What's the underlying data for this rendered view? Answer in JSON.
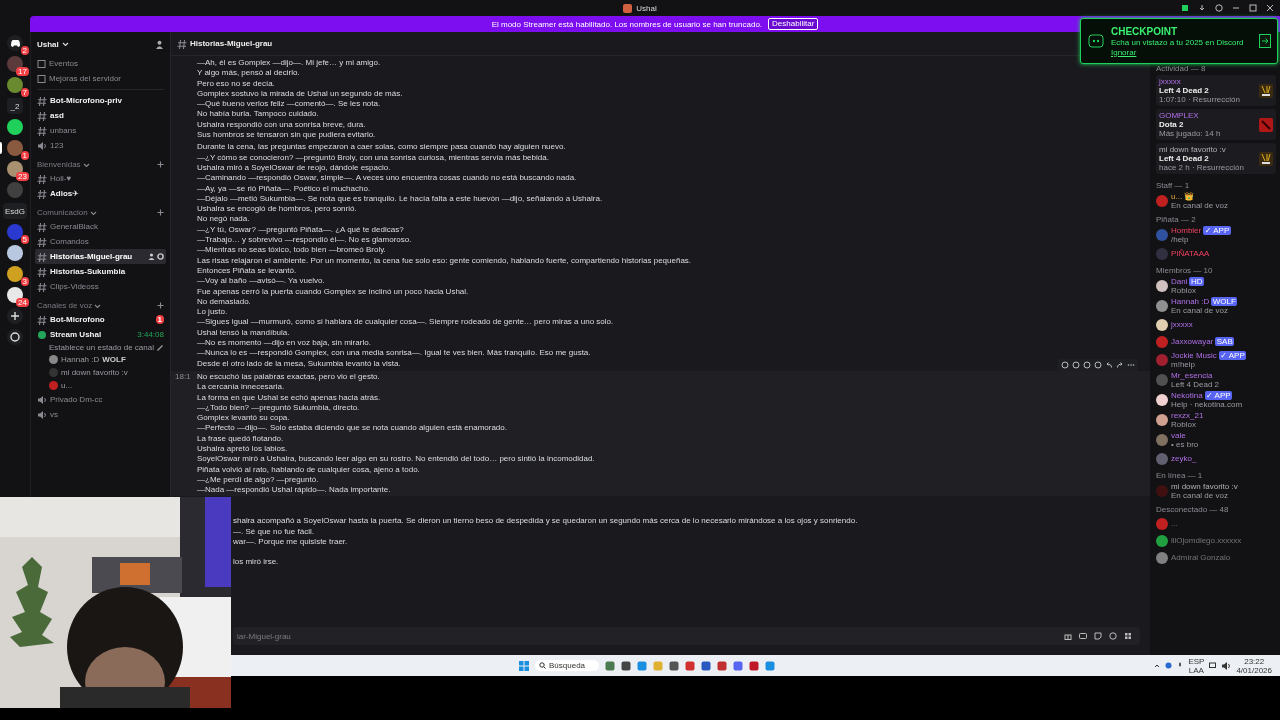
{
  "window": {
    "title": "Ushal"
  },
  "banner": {
    "text": "El modo Streamer está habilitado. Los nombres de usuario se han truncado.",
    "button": "Deshabilitar"
  },
  "rail": [
    {
      "kind": "discord",
      "badge": "2",
      "selected": false
    },
    {
      "kind": "avatar",
      "color": "#5a3a3a",
      "badge": "17",
      "selected": false
    },
    {
      "kind": "avatar",
      "color": "#6a8a30",
      "badge": "7",
      "selected": false
    },
    {
      "kind": "text",
      "label": "_2",
      "selected": false
    },
    {
      "kind": "avatar",
      "color": "#1fd15a",
      "selected": false
    },
    {
      "kind": "avatar",
      "color": "#8a5a40",
      "badge": "1",
      "selected": true
    },
    {
      "kind": "avatar",
      "color": "#a89070",
      "badge": "23",
      "selected": false
    },
    {
      "kind": "avatar",
      "color": "#404040",
      "selected": false
    },
    {
      "kind": "text",
      "label": "EsdG",
      "selected": false
    },
    {
      "kind": "avatar",
      "color": "#2a3ad0",
      "badge": "5",
      "selected": false
    },
    {
      "kind": "avatar",
      "color": "#b8c8e0",
      "selected": false
    },
    {
      "kind": "avatar",
      "color": "#d0a020",
      "badge": "3",
      "selected": false
    },
    {
      "kind": "avatar",
      "color": "#e8e8e8",
      "badge": "24",
      "selected": false
    },
    {
      "kind": "add"
    },
    {
      "kind": "discover"
    }
  ],
  "sidebar": {
    "server": "Ushal",
    "items": [
      {
        "kind": "nav",
        "label": "Eventos"
      },
      {
        "kind": "nav",
        "label": "Mejoras del servidor"
      },
      {
        "kind": "divider"
      },
      {
        "kind": "text",
        "label": "Bot-Microfono-priv",
        "unread": true,
        "selected": false
      },
      {
        "kind": "text",
        "label": "asd",
        "unread": true,
        "selected": false
      },
      {
        "kind": "text",
        "label": "unbans",
        "unread": false,
        "selected": false
      },
      {
        "kind": "voice",
        "label": "123",
        "unread": false,
        "selected": false
      },
      {
        "kind": "category",
        "label": "Bienvenidas"
      },
      {
        "kind": "text",
        "label": "Holi-♥",
        "unread": false,
        "selected": false
      },
      {
        "kind": "text",
        "label": "Adios✈",
        "unread": true,
        "selected": false
      },
      {
        "kind": "category",
        "label": "Comunicacion"
      },
      {
        "kind": "text",
        "label": "GeneralBlack",
        "unread": false,
        "selected": false
      },
      {
        "kind": "text",
        "label": "Comandos",
        "unread": false,
        "selected": false
      },
      {
        "kind": "text",
        "label": "Historias-Miguel-grau",
        "unread": true,
        "selected": true
      },
      {
        "kind": "text",
        "label": "Historias-Sukumbia",
        "unread": true,
        "selected": false
      },
      {
        "kind": "text",
        "label": "Clips-Videoss",
        "unread": false,
        "selected": false
      },
      {
        "kind": "category",
        "label": "Canales de voz"
      },
      {
        "kind": "text",
        "label": "Bot-Microfono",
        "unread": true,
        "selected": false,
        "badge": "1"
      },
      {
        "kind": "stream",
        "label": "Stream Ushal",
        "timer": "3:44:08"
      },
      {
        "kind": "status",
        "label": "Establece un estado de canal"
      },
      {
        "kind": "user",
        "label": "Hannah :D",
        "tag": "WOLF",
        "color": "#888888"
      },
      {
        "kind": "user",
        "label": "mi down favorito :v",
        "color": "#333333"
      },
      {
        "kind": "user",
        "label": "u...",
        "color": "#c02020"
      },
      {
        "kind": "voice",
        "label": "Privado Dm-cc",
        "unread": false,
        "selected": false
      },
      {
        "kind": "voice",
        "label": "vs",
        "unread": false,
        "selected": false
      }
    ]
  },
  "channel": {
    "name": "Historias-Miguel-grau"
  },
  "messages": [
    {
      "hovered": false,
      "cut": false,
      "lines": [
        "—Ah, él es Gomplex —dijo—. Mi jefe… y mi amigo.",
        "Y algo más, pensó al decirlo.",
        "Pero eso no se decía.",
        "Gomplex sostuvo la mirada de Ushal un segundo de más.",
        "—Qué bueno verlos feliz —comentó—. Se les nota.",
        "No había burla. Tampoco cuidado.",
        "Ushalra respondió con una sonrisa breve, dura.",
        "Sus hombros se tensaron sin que pudiera evitarlo."
      ]
    },
    {
      "hovered": false,
      "cut": false,
      "lines": [
        "Durante la cena, las preguntas empezaron a caer solas, como siempre pasa cuando hay alguien nuevo.",
        "—¿Y cómo se conocieron? —preguntó Broly, con una sonrisa curiosa, mientras servía más bebida.",
        "Ushalra miró a SoyelOswar de reojo, dándole espacio.",
        "—Caminando —respondió Oswar, simple—. A veces uno encuentra cosas cuando no está buscando nada.",
        "—Ay, ya —se rió Piñata—. Poético el muchacho.",
        "—Déjalo —metió Sukumbia—. Se nota que es tranquilo. Le hacía falta a este huevón —dijo, señalando a Ushalra.",
        "Ushalra se encogió de hombros, pero sonrió.",
        "No negó nada.",
        "—¿Y tú, Oswar? —preguntó Piñata—. ¿A qué te dedicas?",
        "—Trabajo… y sobrevivo —respondió él—. No es glamoroso.",
        "—Mientras no seas tóxico, todo bien —bromeó Broly.",
        "Las risas relajaron el ambiente. Por un momento, la cena fue solo eso: gente comiendo, hablando fuerte, compartiendo historias pequeñas.",
        "Entonces Piñata se levantó.",
        "—Voy al baño —avisó—. Ya vuelvo.",
        "Fue apenas cerró la puerta cuando Gomplex se inclinó un poco hacia Ushal.",
        "No demasiado.",
        "Lo justo.",
        "—Sigues igual —murmuró, como si hablara de cualquier cosa—. Siempre rodeado de gente… pero miras a uno solo.",
        "Ushal tensó la mandíbula.",
        "—No es momento —dijo en voz baja, sin mirarlo.",
        "—Nunca lo es —respondió Gomplex, con una media sonrisa—. Igual te ves bien. Más tranquilo. Eso me gusta.",
        "Desde el otro lado de la mesa, Sukumbia levantó la vista."
      ]
    },
    {
      "hovered": true,
      "cut": false,
      "time": "18:1",
      "lines": [
        "No escuchó las palabras exactas, pero vio el gesto.",
        "La cercanía innecesaria.",
        "La forma en que Ushal se echó apenas hacia atrás.",
        "—¿Todo bien? —preguntó Sukumbia, directo.",
        "Gomplex levantó su copa.",
        "—Perfecto —dijo—. Solo estaba diciendo que se nota cuando alguien está enamorado.",
        "La frase quedó flotando.",
        "Ushalra apretó los labios.",
        "SoyelOswar miró a Ushalra, buscando leer algo en su rostro. No entendió del todo… pero sintió la incomodidad.",
        "Piñata volvió al rato, hablando de cualquier cosa, ajeno a todo.",
        "—¿Me perdí de algo? —preguntó.",
        "—Nada —respondió Ushal rápido—. Nada importante."
      ]
    },
    {
      "hovered": false,
      "cut": true,
      "lines": [
        "shalra acompañó a SoyelOswar hasta la puerta. Se dieron un tierno beso de despedida y se quedaron un segundo más cerca de lo necesario mirándose a los ojos y sonriendo.",
        "—. Sé que no fue fácil.",
        "war—. Porque me quisiste traer."
      ]
    },
    {
      "hovered": false,
      "cut": true,
      "lines": [
        "los miró irse."
      ]
    }
  ],
  "composer": {
    "placeholder": "iar-Miguel-grau"
  },
  "checkpoint": {
    "title": "CHECKPOINT",
    "text": "Echa un vistazo a tu 2025 en Discord",
    "dismiss": "Ignorar"
  },
  "members": {
    "activity": {
      "title": "Actividad — 8",
      "cards": [
        {
          "user": {
            "name": "jxxxxx",
            "kind": "member"
          },
          "game": {
            "title": "Left 4 Dead 2",
            "kind": "l4d"
          },
          "meta": "1:07:10 · Resurrección"
        },
        {
          "user": {
            "name": "GOMPLEX",
            "kind": "member"
          },
          "game": {
            "title": "Dota 2",
            "kind": "dota"
          },
          "meta": "Más jugado: 14 h"
        },
        {
          "user": {
            "name": "mi down favorito :v",
            "kind": "plain"
          },
          "game": {
            "title": "Left 4 Dead 2",
            "kind": "l4d"
          },
          "meta": "hace 2 h · Resurrección"
        }
      ]
    },
    "groups": [
      {
        "title": "Staff — 1",
        "members": [
          {
            "name": "u... 👑",
            "kind": "staff",
            "status": "En canal de voz",
            "avatar": {
              "color": "#c02020"
            },
            "faded": false
          }
        ]
      },
      {
        "title": "Piñata — 2",
        "members": [
          {
            "name": "Hombler",
            "kind": "pinata",
            "tag": "✓ APP",
            "status": "/help",
            "avatar": {
              "color": "#3050a0"
            },
            "faded": false
          },
          {
            "name": "PIÑATAAA",
            "kind": "pinata",
            "avatar": {
              "color": "#303040"
            },
            "faded": false
          }
        ]
      },
      {
        "title": "Miembros — 10",
        "members": [
          {
            "name": "Dani",
            "kind": "member",
            "tag": "HD",
            "status": "Roblox",
            "avatar": {
              "color": "#d0c0c0"
            },
            "faded": false
          },
          {
            "name": "Hannah :D",
            "kind": "member",
            "tag": "WOLF",
            "status": "En canal de voz",
            "avatar": {
              "color": "#909090"
            },
            "faded": false
          },
          {
            "name": "jxxxxx",
            "kind": "member",
            "avatar": {
              "color": "#e0d0b0"
            },
            "faded": false
          },
          {
            "name": "Jaxxowayar",
            "kind": "member",
            "tag": "SAB",
            "avatar": {
              "color": "#c02020"
            },
            "faded": false
          },
          {
            "name": "Jockie Music",
            "kind": "member",
            "tag": "✓ APP",
            "status": "m!help",
            "avatar": {
              "color": "#a02030"
            },
            "faded": false
          },
          {
            "name": "Mr_esencia",
            "kind": "member",
            "status": "Left 4 Dead 2",
            "avatar": {
              "color": "#505050"
            },
            "faded": false
          },
          {
            "name": "Nekotina",
            "kind": "member",
            "tag": "✓ APP",
            "status": "Help · nekotina.com",
            "avatar": {
              "color": "#f0d0d0"
            },
            "faded": false
          },
          {
            "name": "rexzx_21",
            "kind": "member",
            "status": "Roblox",
            "avatar": {
              "color": "#d0a090"
            },
            "faded": false
          },
          {
            "name": "vale",
            "kind": "member",
            "status": "• es bro",
            "avatar": {
              "color": "#807060"
            },
            "faded": false
          },
          {
            "name": "zeyko_",
            "kind": "member",
            "avatar": {
              "color": "#606070"
            },
            "faded": false
          }
        ]
      },
      {
        "title": "En línea — 1",
        "members": [
          {
            "name": "mi down favorito :v",
            "kind": "plain",
            "status": "En canal de voz",
            "avatar": {
              "color": "#401010"
            },
            "faded": false
          }
        ]
      },
      {
        "title": "Desconectado — 48",
        "members": [
          {
            "name": "...",
            "kind": "plain",
            "avatar": {
              "color": "#c02020"
            },
            "faded": true
          },
          {
            "name": "lilOjomdiego.xxxxxx",
            "kind": "plain",
            "avatar": {
              "color": "#20a040"
            },
            "faded": true
          },
          {
            "name": "Admiral Gonzalo",
            "kind": "plain",
            "avatar": {
              "color": "#808080"
            },
            "faded": true
          }
        ]
      }
    ]
  },
  "taskbar": {
    "search": "Búsqueda",
    "lang": "ESP",
    "layout": "LAA",
    "time": "23:22",
    "date": "4/01/2026"
  }
}
